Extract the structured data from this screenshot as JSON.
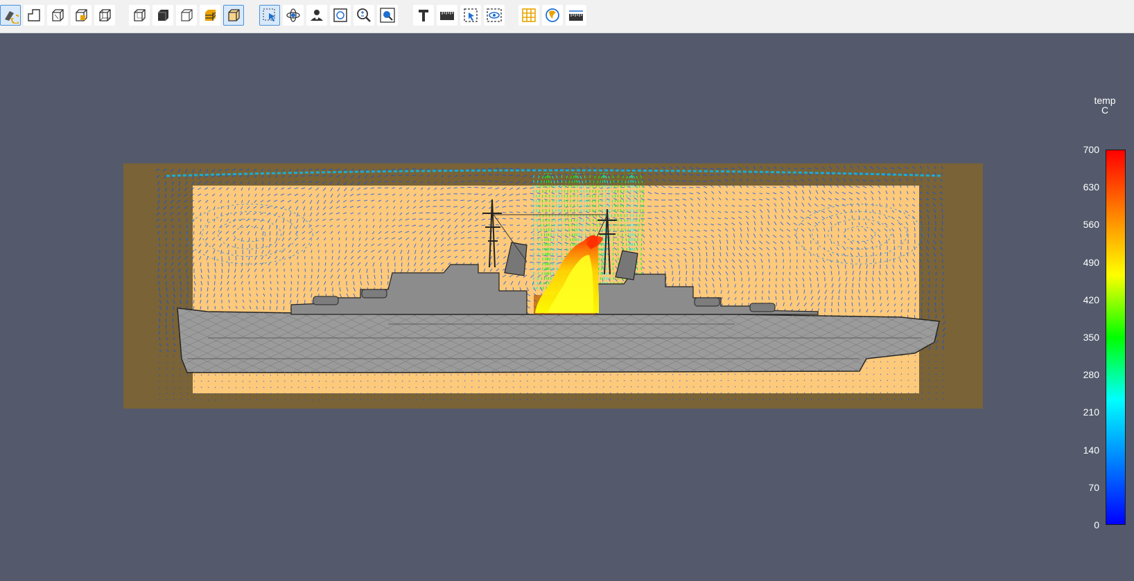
{
  "toolbar": {
    "groups": [
      [
        {
          "name": "reset-camera-icon",
          "active": true
        },
        {
          "name": "show-orientation-axes-icon",
          "active": false
        },
        {
          "name": "outline-representation-icon",
          "active": false
        },
        {
          "name": "surface-with-edges-icon",
          "active": false
        },
        {
          "name": "wireframe-icon",
          "active": false
        }
      ],
      [
        {
          "name": "view-cube-icon",
          "active": false
        },
        {
          "name": "solid-cube-icon",
          "active": false
        },
        {
          "name": "transparent-cube-icon",
          "active": false
        },
        {
          "name": "layered-volume-icon",
          "active": false
        },
        {
          "name": "highlighted-cube-icon",
          "active": true
        }
      ],
      [
        {
          "name": "select-pointer-icon",
          "active": true
        },
        {
          "name": "rotate-icon",
          "active": false
        },
        {
          "name": "camera-eye-icon",
          "active": false
        },
        {
          "name": "fit-to-view-icon",
          "active": false
        },
        {
          "name": "zoom-icon",
          "active": false
        },
        {
          "name": "zoom-box-icon",
          "active": false
        }
      ],
      [
        {
          "name": "text-annotation-icon",
          "active": false
        },
        {
          "name": "ruler-icon",
          "active": false
        },
        {
          "name": "select-region-icon",
          "active": false
        },
        {
          "name": "visibility-icon",
          "active": false
        }
      ],
      [
        {
          "name": "grid-icon",
          "active": false
        },
        {
          "name": "light-icon",
          "active": false
        },
        {
          "name": "measure-icon",
          "active": false
        }
      ]
    ],
    "accent_color": "#4a90d9",
    "icon_highlight": "#e8a400"
  },
  "legend": {
    "title": "temp",
    "unit": "C",
    "ticks": [
      "700",
      "630",
      "560",
      "490",
      "420",
      "350",
      "280",
      "210",
      "140",
      "70",
      "0"
    ],
    "min": 0,
    "max": 700,
    "colormap": [
      "#0000ff",
      "#0080ff",
      "#00ffff",
      "#00ff00",
      "#ffff00",
      "#ff8000",
      "#ff0000"
    ]
  },
  "scene": {
    "background_color": "#545a6c",
    "domain_outer_color": "#7a6336",
    "domain_inner_color": "#fdc97a",
    "hull_color": "#9b9b9b"
  }
}
